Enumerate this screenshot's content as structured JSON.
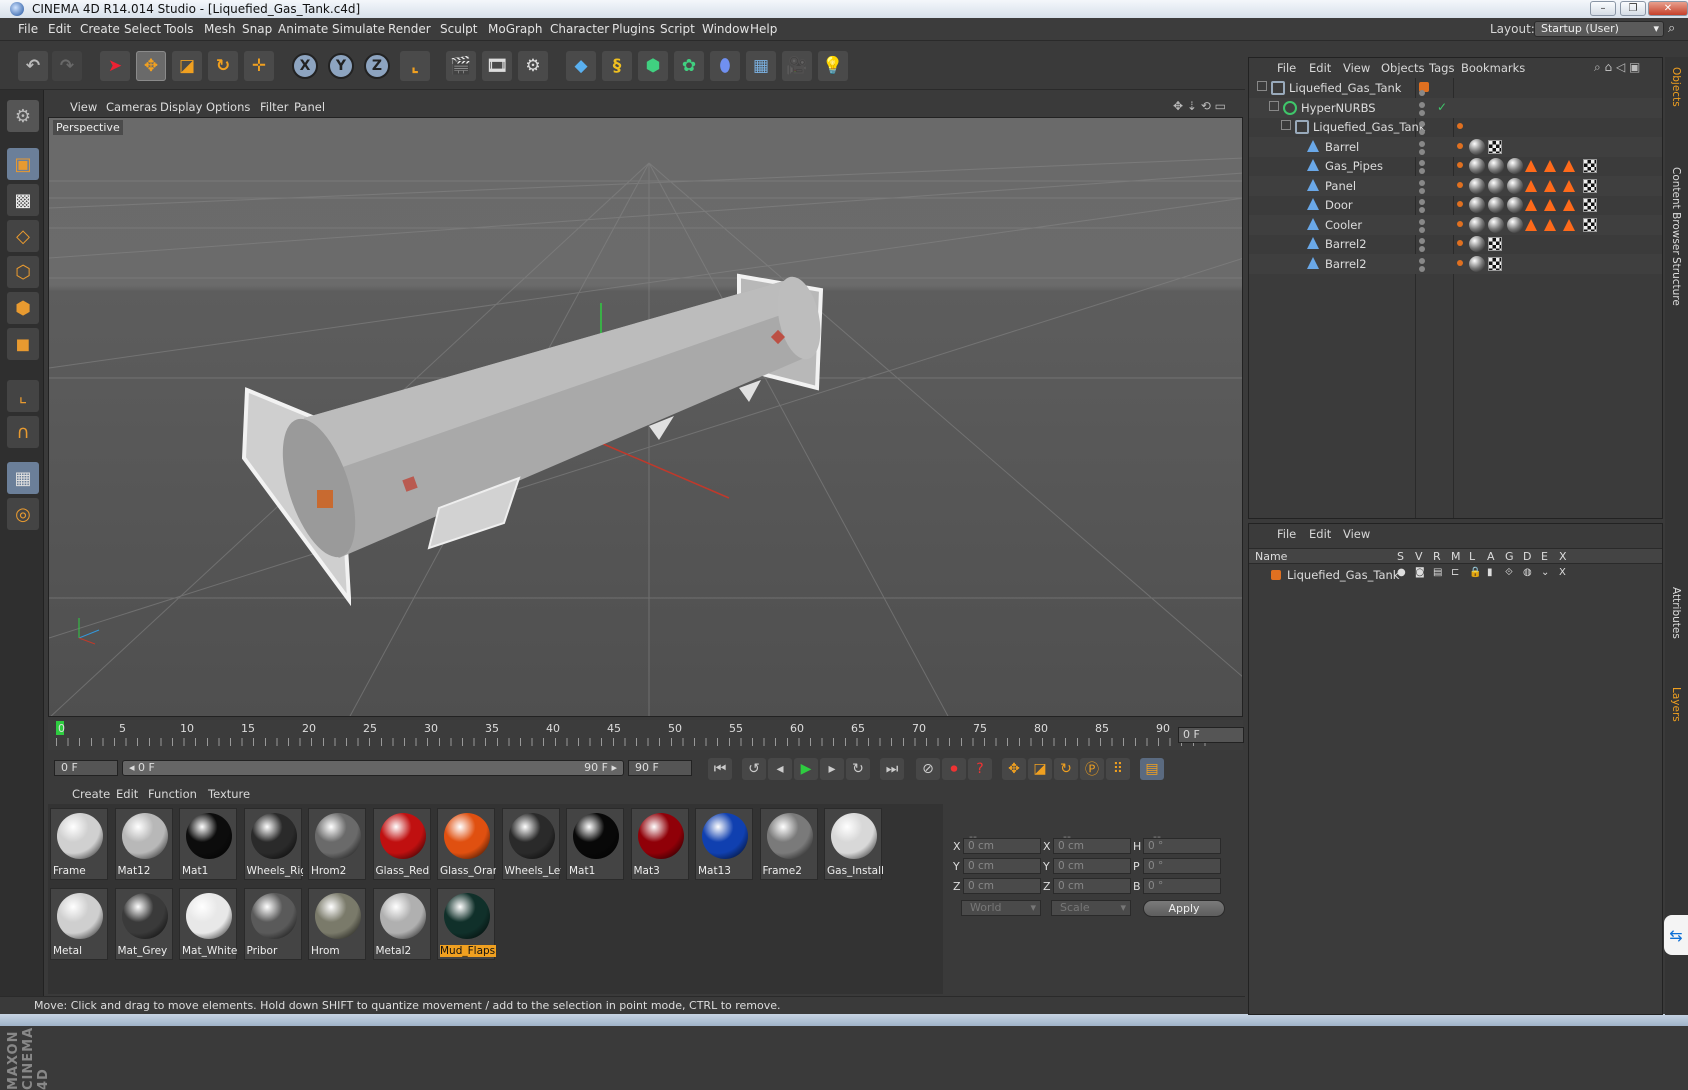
{
  "window": {
    "title": "CINEMA 4D R14.014 Studio - [Liquefied_Gas_Tank.c4d]",
    "minimize": "–",
    "restore": "❐",
    "close": "✕"
  },
  "menubar": {
    "items": [
      "File",
      "Edit",
      "Create",
      "Select",
      "Tools",
      "Mesh",
      "Snap",
      "Animate",
      "Simulate",
      "Render",
      "Sculpt",
      "MoGraph",
      "Character",
      "Plugins",
      "Script",
      "Window",
      "Help"
    ],
    "layout_label": "Layout:",
    "layout_value": "Startup (User)"
  },
  "toolbar": {
    "axis_x": "X",
    "axis_y": "Y",
    "axis_z": "Z"
  },
  "viewport": {
    "menu": [
      "View",
      "Cameras",
      "Display",
      "Options",
      "Filter",
      "Panel"
    ],
    "label": "Perspective"
  },
  "timeline": {
    "ticks": [
      "0",
      "5",
      "10",
      "15",
      "20",
      "25",
      "30",
      "35",
      "40",
      "45",
      "50",
      "55",
      "60",
      "65",
      "70",
      "75",
      "80",
      "85",
      "90"
    ],
    "current_frame": "0 F",
    "start_field": "0 F",
    "range_start": "◂ 0 F",
    "range_end": "90 F ▸",
    "end_field": "90 F"
  },
  "materials": {
    "menu": [
      "Create",
      "Edit",
      "Function",
      "Texture"
    ],
    "row1": [
      {
        "name": "Frame",
        "color": "#d0d0d0"
      },
      {
        "name": "Mat12",
        "color": "#b8b8b8"
      },
      {
        "name": "Mat1",
        "color": "#0c0c0c"
      },
      {
        "name": "Wheels_Rig",
        "color": "#2a2a2a"
      },
      {
        "name": "Hrom2",
        "color": "#6a6a6a"
      },
      {
        "name": "Glass_Red",
        "color": "#c01010"
      },
      {
        "name": "Glass_Oran",
        "color": "#e05010"
      },
      {
        "name": "Wheels_Lef",
        "color": "#2a2a2a"
      },
      {
        "name": "Mat1",
        "color": "#080808"
      },
      {
        "name": "Mat3",
        "color": "#900008"
      },
      {
        "name": "Mat13",
        "color": "#1040b0"
      },
      {
        "name": "Frame2",
        "color": "#7a7a7a"
      },
      {
        "name": "Gas_Install",
        "color": "#d8d8d8"
      }
    ],
    "row2": [
      {
        "name": "Metal",
        "color": "#cfcfcf"
      },
      {
        "name": "Mat_Grey",
        "color": "#3a3a3a"
      },
      {
        "name": "Mat_White",
        "color": "#e8e8e8"
      },
      {
        "name": "Pribor",
        "color": "#5a5a5a"
      },
      {
        "name": "Hrom",
        "color": "#7a7a6a"
      },
      {
        "name": "Metal2",
        "color": "#b0b0b0"
      },
      {
        "name": "Mud_Flaps",
        "color": "#10302a"
      }
    ]
  },
  "coords": {
    "header": [
      "--",
      "--",
      "--"
    ],
    "rows": [
      {
        "a": "X",
        "av": "0 cm",
        "b": "X",
        "bv": "0 cm",
        "c": "H",
        "cv": "0 °"
      },
      {
        "a": "Y",
        "av": "0 cm",
        "b": "Y",
        "bv": "0 cm",
        "c": "P",
        "cv": "0 °"
      },
      {
        "a": "Z",
        "av": "0 cm",
        "b": "Z",
        "bv": "0 cm",
        "c": "B",
        "cv": "0 °"
      }
    ],
    "space": "World",
    "mode": "Scale",
    "apply": "Apply"
  },
  "status": "Move: Click and drag to move elements. Hold down SHIFT to quantize movement / add to the selection in point mode, CTRL to remove.",
  "objects": {
    "menu": [
      "File",
      "Edit",
      "View",
      "Objects",
      "Tags",
      "Bookmarks"
    ],
    "tree": [
      {
        "name": "Liquefied_Gas_Tank",
        "indent": 0,
        "icon": "null"
      },
      {
        "name": "HyperNURBS",
        "indent": 1,
        "icon": "nurbs"
      },
      {
        "name": "Liquefied_Gas_Tank",
        "indent": 2,
        "icon": "null"
      },
      {
        "name": "Barrel",
        "indent": 3,
        "icon": "poly",
        "tags": 2
      },
      {
        "name": "Gas_Pipes",
        "indent": 3,
        "icon": "poly",
        "tags": 7
      },
      {
        "name": "Panel",
        "indent": 3,
        "icon": "poly",
        "tags": 7
      },
      {
        "name": "Door",
        "indent": 3,
        "icon": "poly",
        "tags": 7
      },
      {
        "name": "Cooler",
        "indent": 3,
        "icon": "poly",
        "tags": 7
      },
      {
        "name": "Barrel2",
        "indent": 3,
        "icon": "poly",
        "tags": 2
      },
      {
        "name": "Barrel2",
        "indent": 3,
        "icon": "poly",
        "tags": 2
      }
    ]
  },
  "layers": {
    "menu": [
      "File",
      "Edit",
      "View"
    ],
    "columns": [
      "Name",
      "S",
      "V",
      "R",
      "M",
      "L",
      "A",
      "G",
      "D",
      "E",
      "X"
    ],
    "rows": [
      "Liquefied_Gas_Tank"
    ],
    "layer_color": "#e07020"
  },
  "sidetabs": [
    "Objects",
    "Content Browser",
    "Structure",
    "Attributes",
    "Layers"
  ],
  "brand": "MAXON CINEMA 4D"
}
